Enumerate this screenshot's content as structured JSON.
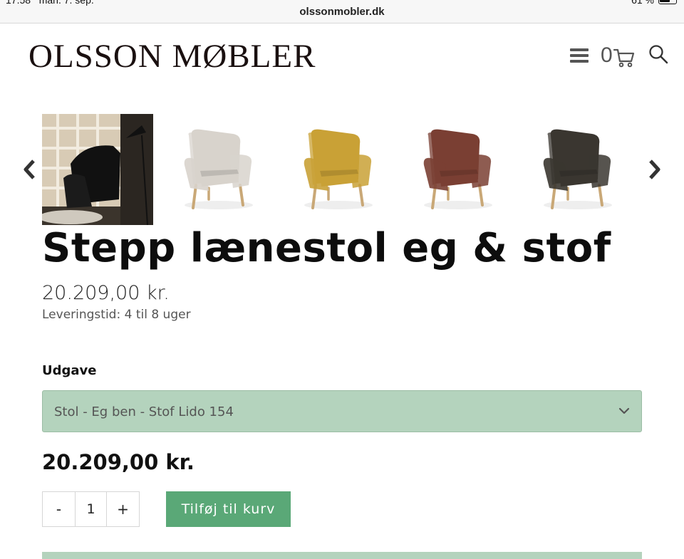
{
  "status_bar": {
    "time": "17.58",
    "date": "man. 7. sep.",
    "battery": "61 %"
  },
  "browser": {
    "url": "olssonmobler.dk"
  },
  "header": {
    "logo_text": "OLSSON MØBLER",
    "cart_count": "0",
    "icons": [
      "menu-icon",
      "cart-icon",
      "search-icon"
    ]
  },
  "gallery": {
    "images": [
      {
        "name": "lifestyle-photo",
        "color": "#2a2520"
      },
      {
        "name": "chair-beige",
        "color": "#d8d3cc"
      },
      {
        "name": "chair-yellow",
        "color": "#c9a136"
      },
      {
        "name": "chair-rust",
        "color": "#7a3f33"
      },
      {
        "name": "chair-dark",
        "color": "#3a3630"
      }
    ],
    "prev_icon": "chevron-left-icon",
    "next_icon": "chevron-right-icon"
  },
  "product": {
    "title": "Stepp lænestol eg & stof",
    "price": "20.209,00 kr.",
    "delivery": "Leveringstid: 4 til 8 uger",
    "variant_label": "Udgave",
    "variant_selected": "Stol - Eg ben - Stof Lido 154",
    "price_total": "20.209,00 kr.",
    "quantity": "1",
    "qty_minus": "-",
    "qty_plus": "+",
    "add_to_cart": "Tilføj til kurv"
  },
  "colors": {
    "accent_green": "#5aa877",
    "select_bg": "#b4d3bd"
  }
}
